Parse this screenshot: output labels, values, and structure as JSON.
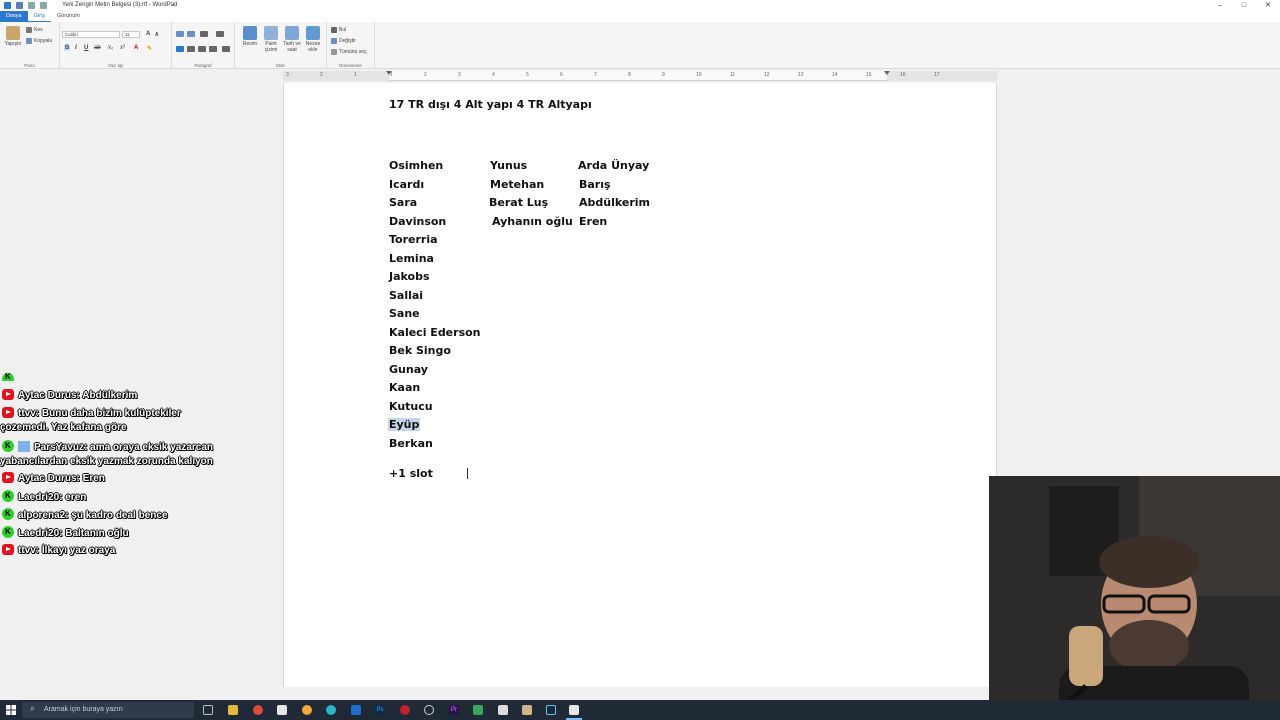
{
  "window": {
    "title": "Yeni Zengin Metin Belgesi (3).rtf - WordPad",
    "controls": [
      "–",
      "□",
      "✕"
    ]
  },
  "ribbon_tabs": [
    "Dosya",
    "Giriş",
    "Görünüm"
  ],
  "ribbon": {
    "clipboard": {
      "paste": "Yapıştır",
      "cut": "Kes",
      "copy": "Kopyala",
      "label": "Pano"
    },
    "font": {
      "family": "Calibri",
      "size": "11",
      "label": "Yazı tipi"
    },
    "paragraph": {
      "label": "Paragraf"
    },
    "insert": {
      "picture": "Resim",
      "paint": "Paint çizimi",
      "datetime": "Tarih ve saat",
      "object": "Nesne ekle",
      "label": "Ekle"
    },
    "editing": {
      "find": "Bul",
      "replace": "Değiştir",
      "select_all": "Tümünü seç",
      "label": "Düzenleme"
    }
  },
  "ruler": {
    "numbers": [
      "3",
      "2",
      "1",
      "1",
      "2",
      "3",
      "4",
      "5",
      "6",
      "7",
      "8",
      "9",
      "10",
      "11",
      "12",
      "13",
      "14",
      "15",
      "16",
      "17"
    ]
  },
  "document": {
    "heading": "17 TR dışı 4 Alt yapı 4 TR Altyapı",
    "col1": [
      "Osimhen",
      "Icardı",
      "Sara",
      "Davinson",
      "Torerria",
      "Lemina",
      "Jakobs",
      "Sallai",
      "Sane",
      "Kaleci Ederson",
      "Bek Singo",
      "Gunay",
      "Kaan",
      "Kutucu",
      "Eyüp",
      "Berkan"
    ],
    "col2": [
      "Yunus",
      "Metehan",
      "Berat Luş",
      "Ayhanın oğlu"
    ],
    "col3": [
      "Arda Ünyay",
      "Barış",
      "Abdülkerim",
      "Eren"
    ],
    "footer": "+1 slot",
    "selected": "Eyüp"
  },
  "chat": [
    {
      "platform": "youtube",
      "user": "Aytac Durus:",
      "text": "Abdülkerim"
    },
    {
      "platform": "youtube",
      "user": "ttvv:",
      "text": "Bunu daha bizim kulüptekiler",
      "text2": "çozemedi. Yaz kafana göre"
    },
    {
      "platform": "kick",
      "user": "ParsYavuz:",
      "text": "ama oraya eksik yazarcan",
      "text2": "yabancılardan eksik yazmak zorunda kalıyon"
    },
    {
      "platform": "youtube",
      "user": "Aytac Durus:",
      "text": "Eren"
    },
    {
      "platform": "kick",
      "user": "Laedri20:",
      "text": "eren"
    },
    {
      "platform": "kick",
      "user": "alporena2:",
      "text": "şu kadro deal bence"
    },
    {
      "platform": "kick",
      "user": "Laedri20:",
      "text": "Baltanın oğlu"
    },
    {
      "platform": "youtube",
      "user": "ttvv:",
      "text": "İlkayı yaz oraya"
    }
  ],
  "taskbar": {
    "search_placeholder": "Aramak için buraya yazın"
  },
  "colors": {
    "accent": "#2b78d1",
    "selection": "#c6d6ea",
    "taskbar": "#1f2a36",
    "kick": "#2cd12c",
    "youtube": "#e0141e"
  }
}
